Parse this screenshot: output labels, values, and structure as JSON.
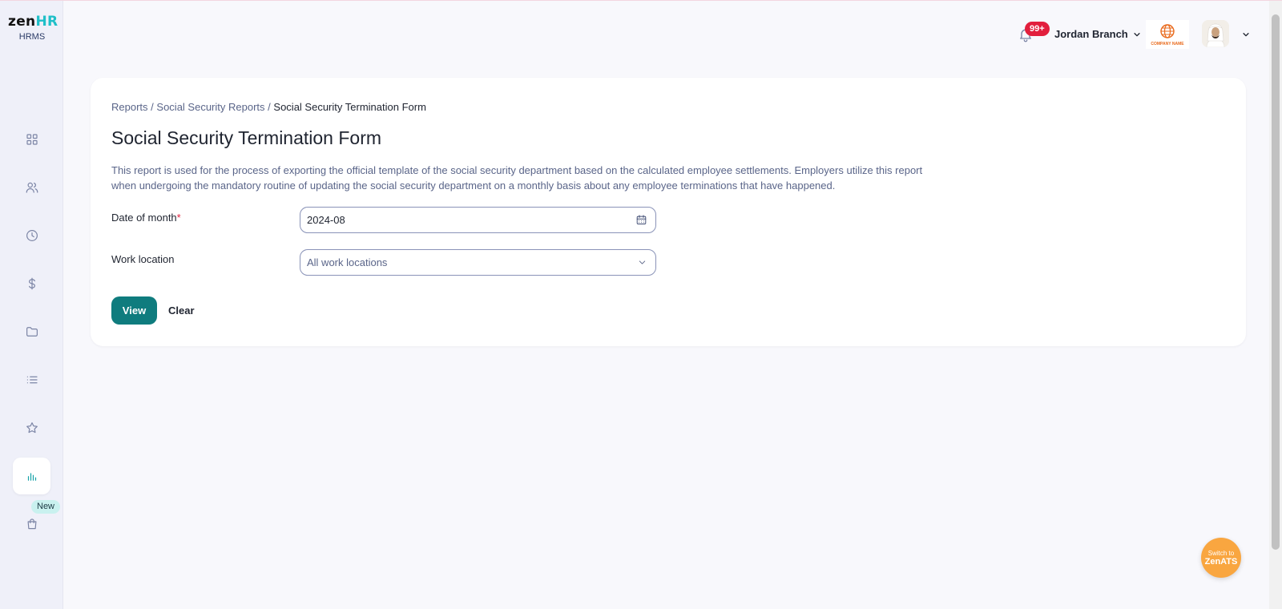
{
  "brand": {
    "logo_main": "zen",
    "logo_accent": "HR",
    "logo_sub": "HRMS"
  },
  "sidebar": {
    "items": [
      {
        "id": "dashboard",
        "icon": "grid-icon"
      },
      {
        "id": "employees",
        "icon": "users-icon"
      },
      {
        "id": "attendance",
        "icon": "clock-icon"
      },
      {
        "id": "payroll",
        "icon": "dollar-icon"
      },
      {
        "id": "documents",
        "icon": "folder-icon"
      },
      {
        "id": "tasks",
        "icon": "list-icon"
      },
      {
        "id": "performance",
        "icon": "star-icon"
      },
      {
        "id": "reports",
        "icon": "bar-chart-icon",
        "active": true
      },
      {
        "id": "marketplace",
        "icon": "bag-icon"
      }
    ],
    "new_badge": "New"
  },
  "header": {
    "notification_count": "99+",
    "branch": "Jordan Branch",
    "company_logo_text": "COMPANY NAME"
  },
  "breadcrumb": {
    "items": [
      "Reports",
      "Social Security Reports"
    ],
    "separator": "/",
    "current": "Social Security Termination Form"
  },
  "page": {
    "title": "Social Security Termination Form",
    "description": "This report is used for the process of exporting the official template of the social security department based on the calculated employee settlements. Employers utilize this report when undergoing the mandatory routine of updating the social security department on a monthly basis about any employee terminations that have happened."
  },
  "form": {
    "date_label": "Date of month",
    "required_mark": "*",
    "date_value": "2024-08",
    "location_label": "Work location",
    "location_value": "All work locations"
  },
  "actions": {
    "view_label": "View",
    "clear_label": "Clear"
  },
  "switch_ats": {
    "line1": "Switch to",
    "line2": "ZenATS"
  },
  "colors": {
    "primary": "#0f7c7e",
    "accent_teal": "#1fbfc8",
    "notification": "#e21f3d",
    "switch_orange": "#f9a640"
  }
}
